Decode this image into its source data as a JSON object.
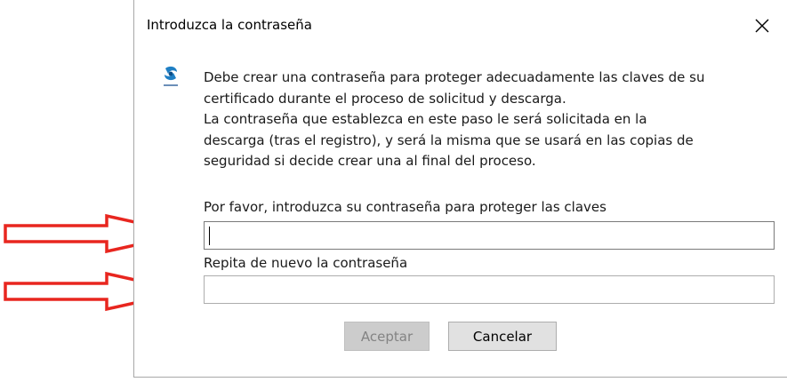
{
  "dialog": {
    "title": "Introduzca la contraseña",
    "close_icon": "close-icon",
    "app_icon": "app-logo-icon",
    "message_lines": [
      "Debe crear una contraseña para proteger adecuadamente las claves de su",
      "certificado durante el proceso de solicitud y descarga.",
      "La contraseña que establezca en este paso le será solicitada en la",
      "descarga (tras el registro), y será la misma que se usará en las copias de",
      "seguridad si decide crear una al final del proceso."
    ],
    "password_label": "Por favor, introduzca su contraseña para proteger las claves",
    "password_value": "",
    "repeat_label": "Repita de nuevo la contraseña",
    "repeat_value": "",
    "accept_label": "Aceptar",
    "cancel_label": "Cancelar"
  },
  "annotations": {
    "arrow_icon": "arrow-right-icon",
    "arrow_color": "#e8261f"
  },
  "colors": {
    "disabled_button_bg": "#cccccc",
    "disabled_button_text": "#838383",
    "button_bg": "#e1e1e1",
    "logo_blue": "#1f7fc4"
  }
}
